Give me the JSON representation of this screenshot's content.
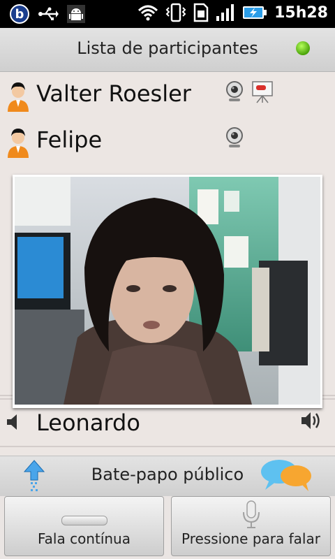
{
  "status_bar": {
    "time": "15h28"
  },
  "header": {
    "title": "Lista de participantes",
    "status_color": "#4aa30a"
  },
  "participants": [
    {
      "name": "Valter Roesler",
      "icons": [
        "webcam-icon",
        "presenter-icon"
      ]
    },
    {
      "name": "Felipe",
      "icons": [
        "webcam-icon"
      ]
    }
  ],
  "audio_row": {
    "name": "Leonardo",
    "icons": [
      "speaker-muted-icon",
      "speaker-icon"
    ]
  },
  "chat_bar": {
    "title": "Bate-papo público",
    "icons": [
      "upload-arrow-icon",
      "chat-bubbles-icon"
    ]
  },
  "buttons": {
    "continuous_label": "Fala contínua",
    "push_to_talk_label": "Pressione para falar"
  }
}
